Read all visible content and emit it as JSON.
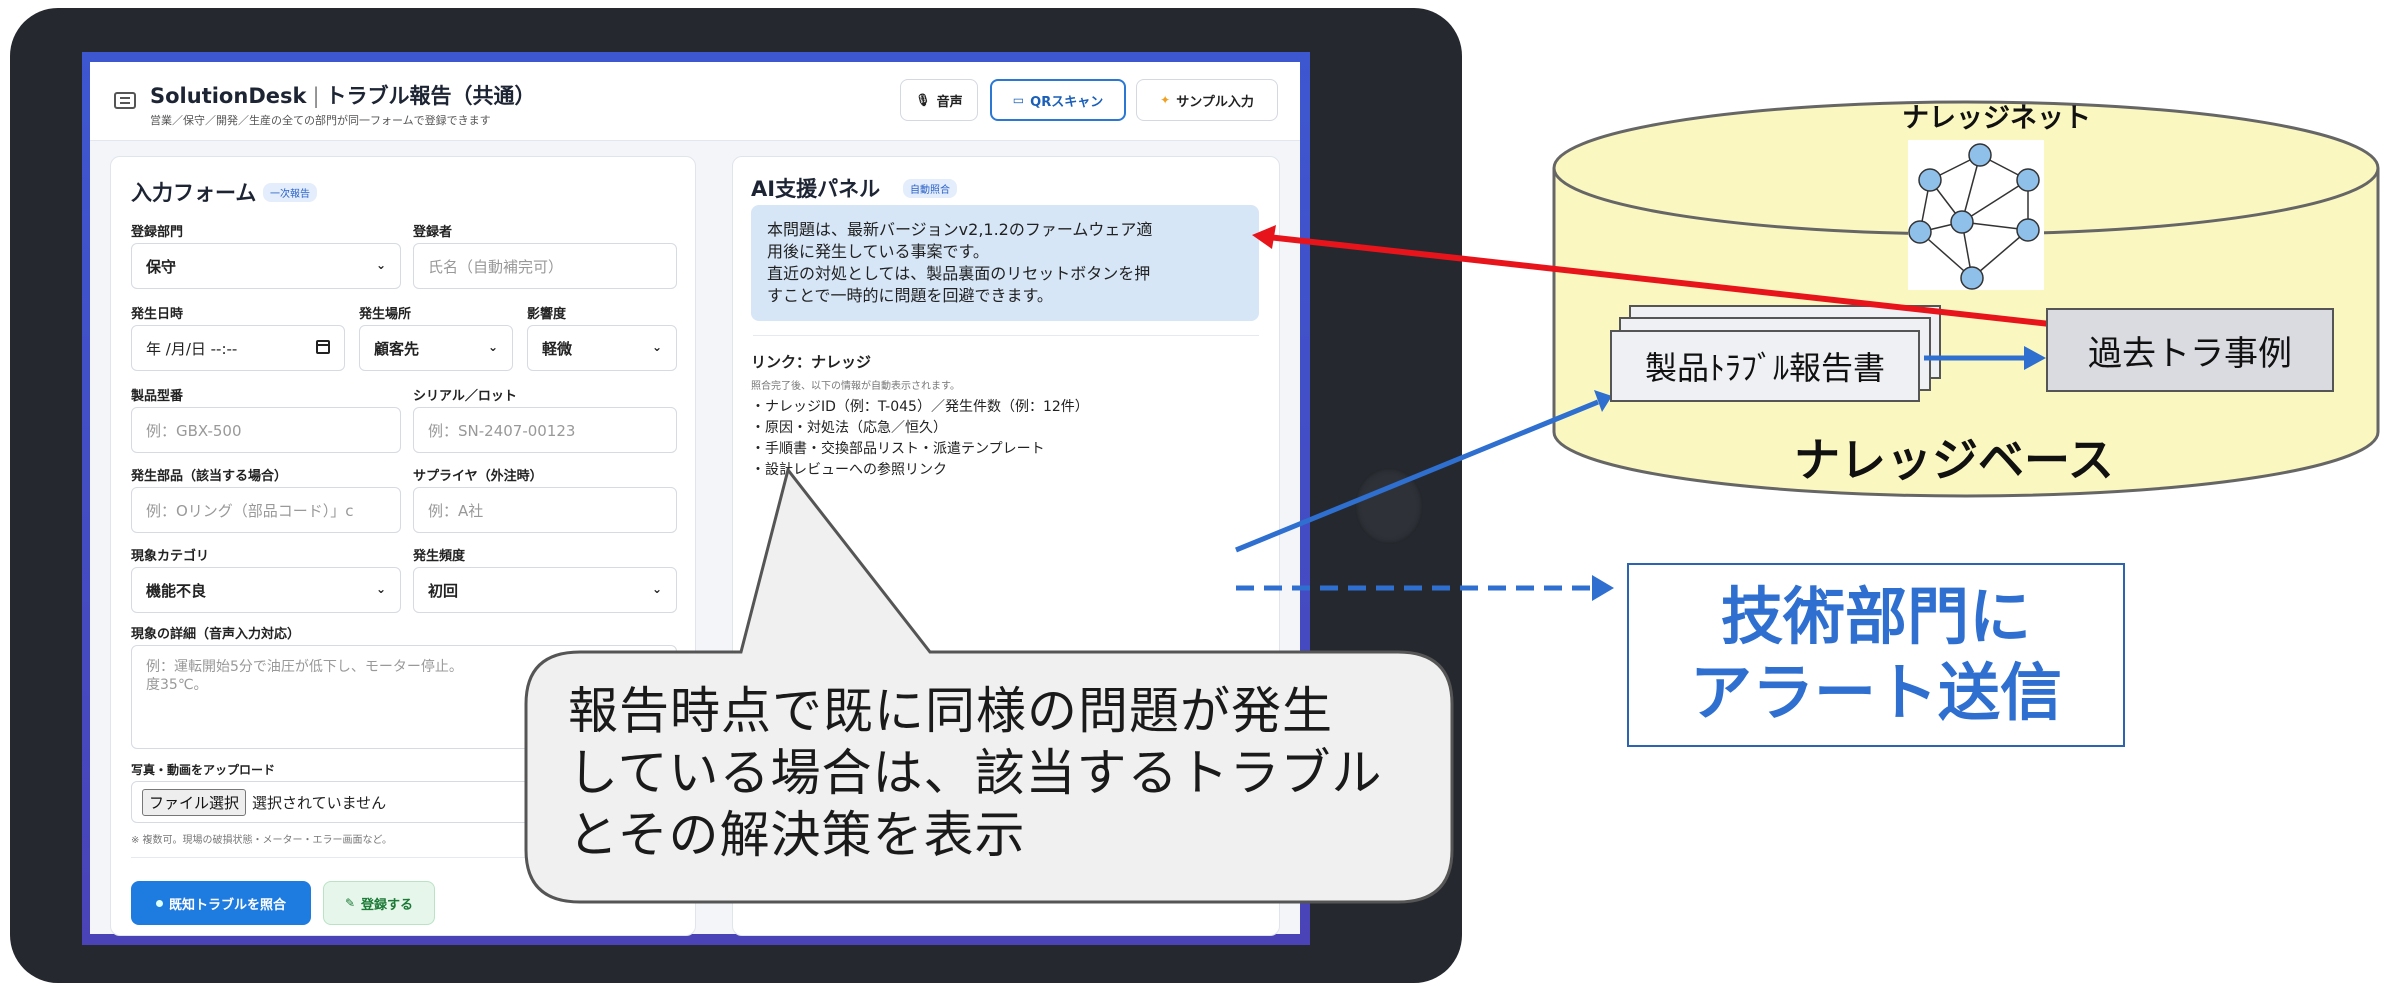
{
  "app": {
    "brand": "SolutionDesk",
    "title": "トラブル報告（共通）",
    "subtitle": "営業／保守／開発／生産の全ての部門が同一フォームで登録できます",
    "buttons": {
      "voice": "音声",
      "qr": "QRスキャン",
      "sample": "サンプル入力"
    }
  },
  "form": {
    "title": "入力フォーム",
    "tag": "一次報告",
    "fields": {
      "department": {
        "label": "登録部門",
        "value": "保守"
      },
      "registrant": {
        "label": "登録者",
        "placeholder": "氏名（自動補完可）"
      },
      "date": {
        "label": "発生日時",
        "value": "年 /月/日 --:--"
      },
      "location": {
        "label": "発生場所",
        "value": "顧客先"
      },
      "impact": {
        "label": "影響度",
        "value": "軽微"
      },
      "model": {
        "label": "製品型番",
        "placeholder": "例：GBX-500"
      },
      "serial": {
        "label": "シリアル／ロット",
        "placeholder": "例：SN-2407-00123"
      },
      "part": {
        "label": "発生部品（該当する場合）",
        "placeholder": "例：Oリング（部品コード）」c"
      },
      "supplier": {
        "label": "サプライヤ（外注時）",
        "placeholder": "例：A社"
      },
      "category": {
        "label": "現象カテゴリ",
        "value": "機能不良"
      },
      "frequency": {
        "label": "発生頻度",
        "value": "初回"
      },
      "detail": {
        "label": "現象の詳細（音声入力対応）",
        "placeholder_line1": "例：運転開始5分で油圧が低下し、モーター停止。",
        "placeholder_line2": "度35℃。"
      },
      "upload": {
        "label": "写真・動画をアップロード",
        "button": "ファイル選択",
        "status": "選択されていません",
        "note": "※ 複数可。現場の破損状態・メーター・エラー画面など。"
      }
    },
    "actions": {
      "match": "既知トラブルを照合",
      "register": "登録する"
    }
  },
  "ai_panel": {
    "title": "AI支援パネル",
    "tag": "自動照合",
    "message_lines": [
      "本問題は、最新バージョンv2,1.2のファームウェア適",
      "用後に発生している事案です。",
      "直近の対処としては、製品裏面のリセットボタンを押",
      "すことで一時的に問題を回避できます。"
    ],
    "link_title": "リンク：ナレッジ",
    "link_sub": "照合完了後、以下の情報が自動表示されます。",
    "link_items": [
      "・ナレッジID（例：T-045）／発生件数（例：12件）",
      "・原因・対処法（応急／恒久）",
      "・手順書・交換部品リスト・派遣テンプレート",
      "・設計レビューへの参照リンク"
    ]
  },
  "callout": {
    "lines": [
      "報告時点で既に同様の問題が発生",
      "している場合は、該当するトラブル",
      "とその解決策を表示"
    ]
  },
  "knowledge": {
    "net_label": "ナレッジネット",
    "report_label": "製品ﾄﾗﾌﾞﾙ報告書",
    "past_label": "過去トラ事例",
    "base_label": "ナレッジベース"
  },
  "alert": {
    "lines": [
      "技術部門に",
      "アラート送信"
    ]
  },
  "colors": {
    "accent_blue": "#1e7be0",
    "alert_blue": "#2e6fd0",
    "red_arrow": "#e8141b",
    "cylinder_fill": "#fbf7c0"
  }
}
